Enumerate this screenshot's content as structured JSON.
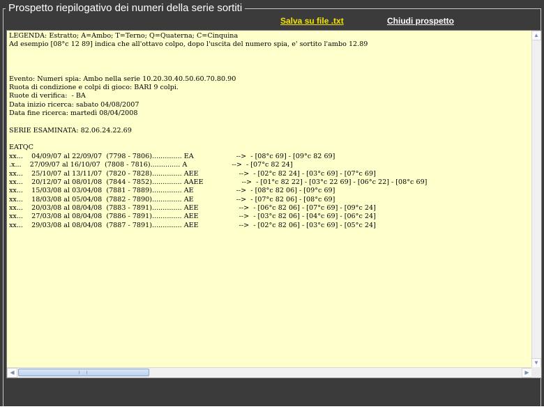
{
  "panel": {
    "title": "Prospetto riepilogativo dei numeri della serie sortiti",
    "save_link": "Salva su file .txt",
    "close_link": "Chiudi prospetto"
  },
  "report": {
    "text": "LEGENDA: Estratto; A=Ambo; T=Terno; Q=Quaterna; C=Cinquina\nAd esempio [08°c 12 89] indica che all'ottavo colpo, dopo l'uscita del numero spia, e' sortito l'ambo 12.89\n\n\n\nEvento: Numeri spia: Ambo nella serie 10.20.30.40.50.60.70.80.90\nRuota di condizione e colpi di gioco: BARI 9 colpi.\nRuote di verifica:  - BA\nData inizio ricerca: sabato 04/08/2007\nData fine ricerca: martedì 08/04/2008\n\nSERIE ESAMINATA: 82.06.24.22.69\n\nEATQC\nxx...    04/09/07 al 22/09/07  (7798 - 7806).............. EA                    -->  - [08°c 69] - [09°c 82 69]\n.x...    27/09/07 al 16/10/07  (7808 - 7816).............. A                     -->  - [07°c 82 24]\nxx...    25/10/07 al 13/11/07  (7820 - 7828).............. AEE                   -->  - [02°c 82 24] - [03°c 69] - [07°c 69]\nxx...    20/12/07 al 08/01/08  (7844 - 7852).............. AAEE                  -->  - [01°c 82 22] - [03°c 22 69] - [06°c 22] - [08°c 69]\nxx...    15/03/08 al 03/04/08  (7881 - 7889).............. AE                    -->  - [08°c 82 06] - [09°c 69]\nxx...    18/03/08 al 05/04/08  (7882 - 7890).............. AE                    -->  - [07°c 82 06] - [08°c 69]\nxx...    20/03/08 al 08/04/08  (7883 - 7891).............. AEE                   -->  - [06°c 82 06] - [07°c 69] - [09°c 24]\nxx...    27/03/08 al 08/04/08  (7886 - 7891).............. AEE                   -->  - [03°c 82 06] - [04°c 69] - [06°c 24]\nxx...    29/03/08 al 08/04/08  (7887 - 7891).............. AEE                   -->  - [02°c 82 06] - [03°c 69] - [05°c 24]"
  },
  "scrollbars": {
    "up_icon": "▲",
    "down_icon": "▼",
    "left_icon": "◀",
    "right_icon": "▶"
  }
}
